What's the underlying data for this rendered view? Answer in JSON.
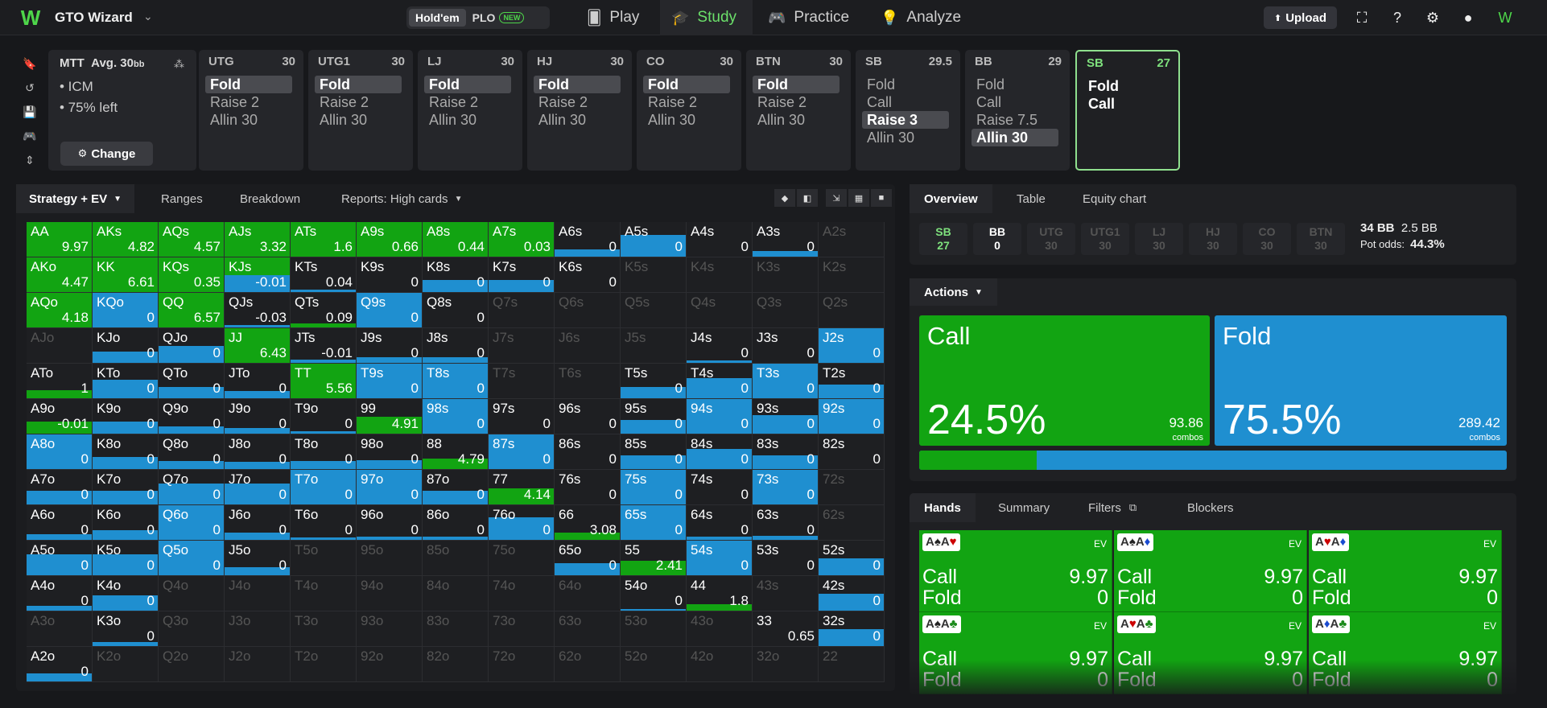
{
  "app": {
    "brand": "GTO Wizard",
    "logo": "W"
  },
  "game_switch": {
    "holdem": "Hold'em",
    "plo": "PLO",
    "new_badge": "NEW"
  },
  "nav": [
    {
      "label": "Play",
      "icon": "cards-icon"
    },
    {
      "label": "Study",
      "icon": "graduation-cap-icon"
    },
    {
      "label": "Practice",
      "icon": "gamepad-icon"
    },
    {
      "label": "Analyze",
      "icon": "bulb-icon"
    }
  ],
  "toolbar": {
    "upload_label": "Upload"
  },
  "settings": {
    "format": "MTT",
    "avg": "Avg. 30",
    "avg_unit": "bb",
    "items": [
      "• ICM",
      "• 75% left"
    ],
    "change_label": "Change"
  },
  "positions": [
    {
      "name": "UTG",
      "stack": "30",
      "actions": [
        "Fold",
        "Raise 2",
        "Allin 30"
      ],
      "selected": 0
    },
    {
      "name": "UTG1",
      "stack": "30",
      "actions": [
        "Fold",
        "Raise 2",
        "Allin 30"
      ],
      "selected": 0
    },
    {
      "name": "LJ",
      "stack": "30",
      "actions": [
        "Fold",
        "Raise 2",
        "Allin 30"
      ],
      "selected": 0
    },
    {
      "name": "HJ",
      "stack": "30",
      "actions": [
        "Fold",
        "Raise 2",
        "Allin 30"
      ],
      "selected": 0
    },
    {
      "name": "CO",
      "stack": "30",
      "actions": [
        "Fold",
        "Raise 2",
        "Allin 30"
      ],
      "selected": 0
    },
    {
      "name": "BTN",
      "stack": "30",
      "actions": [
        "Fold",
        "Raise 2",
        "Allin 30"
      ],
      "selected": 0
    },
    {
      "name": "SB",
      "stack": "29.5",
      "actions": [
        "Fold",
        "Call",
        "Raise 3",
        "Allin 30"
      ],
      "selected": 2
    },
    {
      "name": "BB",
      "stack": "29",
      "actions": [
        "Fold",
        "Call",
        "Raise 7.5",
        "Allin 30"
      ],
      "selected": 3
    },
    {
      "name": "SB",
      "stack": "27",
      "actions": [
        "Fold",
        "Call"
      ],
      "selected": -1
    }
  ],
  "strategy_tabs": [
    "Strategy + EV",
    "Ranges",
    "Breakdown",
    "Reports: High cards"
  ],
  "grid": [
    [
      [
        "AA",
        "9.97",
        "g",
        100
      ],
      [
        "AKs",
        "4.82",
        "g",
        100
      ],
      [
        "AQs",
        "4.57",
        "g",
        100
      ],
      [
        "AJs",
        "3.32",
        "g",
        100
      ],
      [
        "ATs",
        "1.6",
        "g",
        100
      ],
      [
        "A9s",
        "0.66",
        "g",
        100
      ],
      [
        "A8s",
        "0.44",
        "g",
        100
      ],
      [
        "A7s",
        "0.03",
        "g",
        100
      ],
      [
        "A6s",
        "0",
        "b",
        22
      ],
      [
        "A5s",
        "0",
        "b",
        62
      ],
      [
        "A4s",
        "0",
        "n",
        0
      ],
      [
        "A3s",
        "0",
        "b",
        16
      ],
      [
        "A2s",
        "",
        "d",
        0
      ]
    ],
    [
      [
        "AKo",
        "4.47",
        "g",
        100
      ],
      [
        "KK",
        "6.61",
        "g",
        100
      ],
      [
        "KQs",
        "0.35",
        "g",
        100
      ],
      [
        "KJs",
        "-0.01",
        "gb",
        50
      ],
      [
        "KTs",
        "0.04",
        "b",
        6
      ],
      [
        "K9s",
        "0",
        "n",
        0
      ],
      [
        "K8s",
        "0",
        "b",
        36
      ],
      [
        "K7s",
        "0",
        "b",
        36
      ],
      [
        "K6s",
        "0",
        "n",
        0
      ],
      [
        "K5s",
        "",
        "d",
        0
      ],
      [
        "K4s",
        "",
        "d",
        0
      ],
      [
        "K3s",
        "",
        "d",
        0
      ],
      [
        "K2s",
        "",
        "d",
        0
      ]
    ],
    [
      [
        "AQo",
        "4.18",
        "g",
        100
      ],
      [
        "KQo",
        "0",
        "b",
        100
      ],
      [
        "QQ",
        "6.57",
        "g",
        100
      ],
      [
        "QJs",
        "-0.03",
        "b",
        6
      ],
      [
        "QTs",
        "0.09",
        "g",
        12
      ],
      [
        "Q9s",
        "0",
        "b",
        100
      ],
      [
        "Q8s",
        "0",
        "n",
        0
      ],
      [
        "Q7s",
        "",
        "d",
        0
      ],
      [
        "Q6s",
        "",
        "d",
        0
      ],
      [
        "Q5s",
        "",
        "d",
        0
      ],
      [
        "Q4s",
        "",
        "d",
        0
      ],
      [
        "Q3s",
        "",
        "d",
        0
      ],
      [
        "Q2s",
        "",
        "d",
        0
      ]
    ],
    [
      [
        "AJo",
        "",
        "d",
        0
      ],
      [
        "KJo",
        "0",
        "b",
        32
      ],
      [
        "QJo",
        "0",
        "b",
        50
      ],
      [
        "JJ",
        "6.43",
        "g",
        100
      ],
      [
        "JTs",
        "-0.01",
        "b",
        10
      ],
      [
        "J9s",
        "0",
        "b",
        16
      ],
      [
        "J8s",
        "0",
        "b",
        16
      ],
      [
        "J7s",
        "",
        "d",
        0
      ],
      [
        "J6s",
        "",
        "d",
        0
      ],
      [
        "J5s",
        "",
        "d",
        0
      ],
      [
        "J4s",
        "0",
        "b",
        6
      ],
      [
        "J3s",
        "0",
        "n",
        0
      ],
      [
        "J2s",
        "0",
        "b",
        100
      ]
    ],
    [
      [
        "ATo",
        "1",
        "g",
        24
      ],
      [
        "KTo",
        "0",
        "b",
        54
      ],
      [
        "QTo",
        "0",
        "b",
        32
      ],
      [
        "JTo",
        "0",
        "b",
        20
      ],
      [
        "TT",
        "5.56",
        "g",
        100
      ],
      [
        "T9s",
        "0",
        "b",
        100
      ],
      [
        "T8s",
        "0",
        "b",
        100
      ],
      [
        "T7s",
        "",
        "d",
        0
      ],
      [
        "T6s",
        "",
        "d",
        0
      ],
      [
        "T5s",
        "0",
        "b",
        32
      ],
      [
        "T4s",
        "0",
        "b",
        58
      ],
      [
        "T3s",
        "0",
        "b",
        100
      ],
      [
        "T2s",
        "0",
        "b",
        40
      ]
    ],
    [
      [
        "A9o",
        "-0.01",
        "g",
        34
      ],
      [
        "K9o",
        "0",
        "b",
        36
      ],
      [
        "Q9o",
        "0",
        "b",
        20
      ],
      [
        "J9o",
        "0",
        "b",
        16
      ],
      [
        "T9o",
        "0",
        "b",
        8
      ],
      [
        "99",
        "4.91",
        "g",
        48
      ],
      [
        "98s",
        "0",
        "b",
        100
      ],
      [
        "97s",
        "0",
        "n",
        0
      ],
      [
        "96s",
        "0",
        "n",
        0
      ],
      [
        "95s",
        "0",
        "b",
        40
      ],
      [
        "94s",
        "0",
        "b",
        100
      ],
      [
        "93s",
        "0",
        "b",
        54
      ],
      [
        "92s",
        "0",
        "b",
        100
      ]
    ],
    [
      [
        "A8o",
        "0",
        "b",
        100
      ],
      [
        "K8o",
        "0",
        "b",
        36
      ],
      [
        "Q8o",
        "0",
        "b",
        24
      ],
      [
        "J8o",
        "0",
        "b",
        20
      ],
      [
        "T8o",
        "0",
        "b",
        24
      ],
      [
        "98o",
        "0",
        "b",
        26
      ],
      [
        "88",
        "4.79",
        "g",
        30
      ],
      [
        "87s",
        "0",
        "b",
        100
      ],
      [
        "86s",
        "0",
        "n",
        0
      ],
      [
        "85s",
        "0",
        "b",
        40
      ],
      [
        "84s",
        "0",
        "b",
        58
      ],
      [
        "83s",
        "0",
        "b",
        40
      ],
      [
        "82s",
        "0",
        "n",
        0
      ]
    ],
    [
      [
        "A7o",
        "0",
        "b",
        40
      ],
      [
        "K7o",
        "0",
        "b",
        40
      ],
      [
        "Q7o",
        "0",
        "b",
        60
      ],
      [
        "J7o",
        "0",
        "b",
        60
      ],
      [
        "T7o",
        "0",
        "b",
        100
      ],
      [
        "97o",
        "0",
        "b",
        100
      ],
      [
        "87o",
        "0",
        "b",
        40
      ],
      [
        "77",
        "4.14",
        "g",
        46
      ],
      [
        "76s",
        "0",
        "n",
        0
      ],
      [
        "75s",
        "0",
        "b",
        100
      ],
      [
        "74s",
        "0",
        "n",
        0
      ],
      [
        "73s",
        "0",
        "b",
        100
      ],
      [
        "72s",
        "",
        "d",
        0
      ]
    ],
    [
      [
        "A6o",
        "0",
        "b",
        16
      ],
      [
        "K6o",
        "0",
        "b",
        28
      ],
      [
        "Q6o",
        "0",
        "b",
        100
      ],
      [
        "J6o",
        "0",
        "b",
        20
      ],
      [
        "T6o",
        "0",
        "b",
        8
      ],
      [
        "96o",
        "0",
        "b",
        10
      ],
      [
        "86o",
        "0",
        "b",
        10
      ],
      [
        "76o",
        "0",
        "b",
        66
      ],
      [
        "66",
        "3.08",
        "g",
        22
      ],
      [
        "65s",
        "0",
        "b",
        100
      ],
      [
        "64s",
        "0",
        "b",
        10
      ],
      [
        "63s",
        "0",
        "b",
        12
      ],
      [
        "62s",
        "",
        "d",
        0
      ]
    ],
    [
      [
        "A5o",
        "0",
        "b",
        60
      ],
      [
        "K5o",
        "0",
        "b",
        60
      ],
      [
        "Q5o",
        "0",
        "b",
        100
      ],
      [
        "J5o",
        "0",
        "b",
        24
      ],
      [
        "T5o",
        "",
        "d",
        0
      ],
      [
        "95o",
        "",
        "d",
        0
      ],
      [
        "85o",
        "",
        "d",
        0
      ],
      [
        "75o",
        "",
        "d",
        0
      ],
      [
        "65o",
        "0",
        "b",
        34
      ],
      [
        "55",
        "2.41",
        "g",
        42
      ],
      [
        "54s",
        "0",
        "b",
        100
      ],
      [
        "53s",
        "0",
        "n",
        0
      ],
      [
        "52s",
        "0",
        "b",
        50
      ]
    ],
    [
      [
        "A4o",
        "0",
        "b",
        14
      ],
      [
        "K4o",
        "0",
        "b",
        44
      ],
      [
        "Q4o",
        "",
        "d",
        0
      ],
      [
        "J4o",
        "",
        "d",
        0
      ],
      [
        "T4o",
        "",
        "d",
        0
      ],
      [
        "94o",
        "",
        "d",
        0
      ],
      [
        "84o",
        "",
        "d",
        0
      ],
      [
        "74o",
        "",
        "d",
        0
      ],
      [
        "64o",
        "",
        "d",
        0
      ],
      [
        "54o",
        "0",
        "b",
        4
      ],
      [
        "44",
        "1.8",
        "g",
        18
      ],
      [
        "43s",
        "",
        "d",
        0
      ],
      [
        "42s",
        "0",
        "b",
        48
      ]
    ],
    [
      [
        "A3o",
        "",
        "d",
        0
      ],
      [
        "K3o",
        "0",
        "b",
        12
      ],
      [
        "Q3o",
        "",
        "d",
        0
      ],
      [
        "J3o",
        "",
        "d",
        0
      ],
      [
        "T3o",
        "",
        "d",
        0
      ],
      [
        "93o",
        "",
        "d",
        0
      ],
      [
        "83o",
        "",
        "d",
        0
      ],
      [
        "73o",
        "",
        "d",
        0
      ],
      [
        "63o",
        "",
        "d",
        0
      ],
      [
        "53o",
        "",
        "d",
        0
      ],
      [
        "43o",
        "",
        "d",
        0
      ],
      [
        "33",
        "0.65",
        "n",
        0
      ],
      [
        "32s",
        "0",
        "b",
        50
      ]
    ],
    [
      [
        "A2o",
        "0",
        "b",
        24
      ],
      [
        "K2o",
        "",
        "d",
        0
      ],
      [
        "Q2o",
        "",
        "d",
        0
      ],
      [
        "J2o",
        "",
        "d",
        0
      ],
      [
        "T2o",
        "",
        "d",
        0
      ],
      [
        "92o",
        "",
        "d",
        0
      ],
      [
        "82o",
        "",
        "d",
        0
      ],
      [
        "72o",
        "",
        "d",
        0
      ],
      [
        "62o",
        "",
        "d",
        0
      ],
      [
        "52o",
        "",
        "d",
        0
      ],
      [
        "42o",
        "",
        "d",
        0
      ],
      [
        "32o",
        "",
        "d",
        0
      ],
      [
        "22",
        "",
        "d",
        0
      ]
    ]
  ],
  "overview": {
    "tabs": [
      "Overview",
      "Table",
      "Equity chart"
    ],
    "chips": [
      [
        "SB",
        "27",
        "green"
      ],
      [
        "BB",
        "0",
        "bright"
      ],
      [
        "UTG",
        "30",
        "dim"
      ],
      [
        "UTG1",
        "30",
        "dim"
      ],
      [
        "LJ",
        "30",
        "dim"
      ],
      [
        "HJ",
        "30",
        "dim"
      ],
      [
        "CO",
        "30",
        "dim"
      ],
      [
        "BTN",
        "30",
        "dim"
      ]
    ],
    "pot": "34 BB",
    "bet": "2.5 BB",
    "pot_odds_label": "Pot odds:",
    "pot_odds": "44.3%"
  },
  "actions": {
    "label": "Actions",
    "items": [
      {
        "name": "Call",
        "pct": "24.5%",
        "combos": "93.86",
        "color": "#12a412"
      },
      {
        "name": "Fold",
        "pct": "75.5%",
        "combos": "289.42",
        "color": "#1f8fd0"
      }
    ],
    "combos_label": "combos",
    "call_fraction": 0.2
  },
  "hands": {
    "tabs": [
      "Hands",
      "Summary",
      "Filters",
      "Blockers"
    ],
    "ev_label": "EV",
    "cards": [
      {
        "combo": [
          [
            "A",
            "♠",
            "#222"
          ],
          [
            "A",
            "♥",
            "#c00"
          ]
        ],
        "call": "9.97",
        "fold": "0"
      },
      {
        "combo": [
          [
            "A",
            "♠",
            "#222"
          ],
          [
            "A",
            "♦",
            "#1a4bd0"
          ]
        ],
        "call": "9.97",
        "fold": "0"
      },
      {
        "combo": [
          [
            "A",
            "♥",
            "#c00"
          ],
          [
            "A",
            "♦",
            "#1a4bd0"
          ]
        ],
        "call": "9.97",
        "fold": "0"
      },
      {
        "combo": [
          [
            "A",
            "♠",
            "#222"
          ],
          [
            "A",
            "♣",
            "#1b8a1b"
          ]
        ],
        "call": "9.97",
        "fold": "0"
      },
      {
        "combo": [
          [
            "A",
            "♥",
            "#c00"
          ],
          [
            "A",
            "♣",
            "#1b8a1b"
          ]
        ],
        "call": "9.97",
        "fold": "0"
      },
      {
        "combo": [
          [
            "A",
            "♦",
            "#1a4bd0"
          ],
          [
            "A",
            "♣",
            "#1b8a1b"
          ]
        ],
        "call": "9.97",
        "fold": "0"
      }
    ],
    "call_label": "Call",
    "fold_label": "Fold"
  },
  "colors": {
    "green": "#12a412",
    "blue": "#1f8fd0",
    "accent": "#6be06a"
  }
}
